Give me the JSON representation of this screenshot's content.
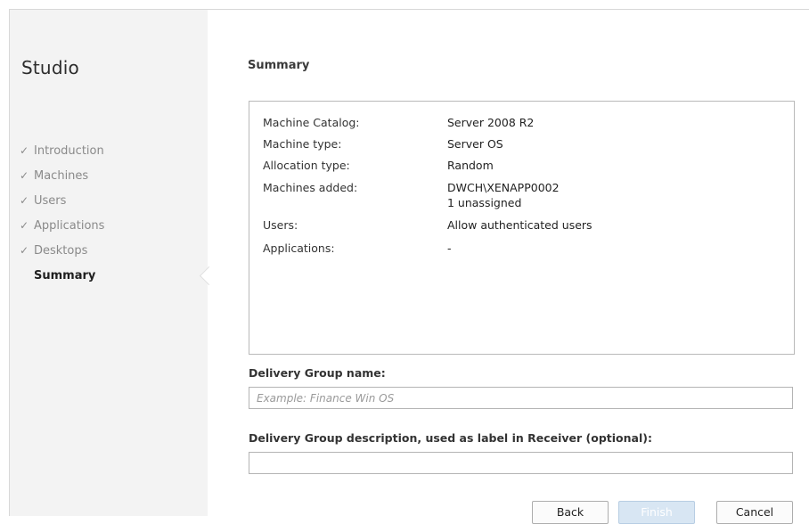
{
  "app": {
    "title": "Studio"
  },
  "sidebar": {
    "steps": [
      {
        "label": "Introduction",
        "done": true
      },
      {
        "label": "Machines",
        "done": true
      },
      {
        "label": "Users",
        "done": true
      },
      {
        "label": "Applications",
        "done": true
      },
      {
        "label": "Desktops",
        "done": true
      },
      {
        "label": "Summary",
        "active": true
      }
    ],
    "check_glyph": "✓"
  },
  "main": {
    "title": "Summary",
    "summary": [
      {
        "key": "Machine Catalog:",
        "value": "Server 2008 R2"
      },
      {
        "key": "Machine type:",
        "value": "Server OS"
      },
      {
        "key": "Allocation type:",
        "value": "Random"
      },
      {
        "key": "Machines added:",
        "value": "DWCH\\XENAPP0002",
        "value2": "1 unassigned"
      },
      {
        "key": "Users:",
        "value": "Allow authenticated users"
      },
      {
        "key": "Applications:",
        "value": "-"
      }
    ],
    "name_label": "Delivery Group name:",
    "name_placeholder": "Example: Finance Win OS",
    "name_value": "",
    "description_label": "Delivery Group description, used as label in Receiver (optional):",
    "description_value": ""
  },
  "buttons": {
    "back": "Back",
    "finish": "Finish",
    "cancel": "Cancel"
  },
  "colors": {
    "sidebar_bg": "#f3f3f3",
    "finish_disabled_bg": "#d8e6f3"
  }
}
